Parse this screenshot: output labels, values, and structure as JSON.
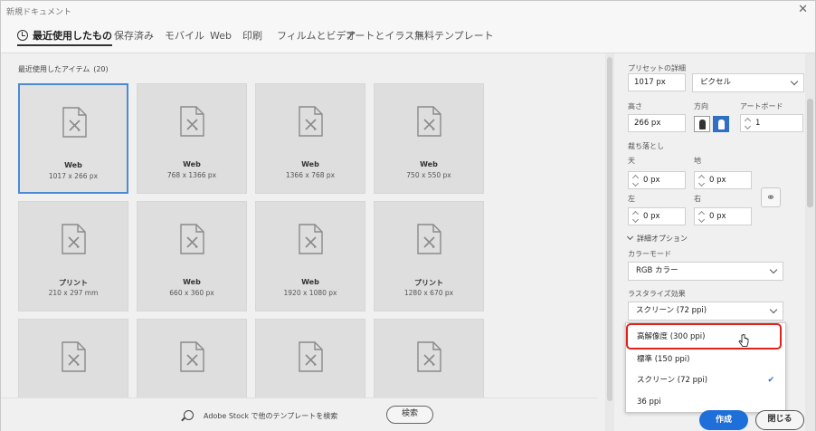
{
  "window": {
    "title": "新規ドキュメント",
    "close_glyph": "✕"
  },
  "tabs": [
    {
      "label": "最近使用したもの",
      "active": true
    },
    {
      "label": "保存済み"
    },
    {
      "label": "モバイル"
    },
    {
      "label": "Web"
    },
    {
      "label": "印刷"
    },
    {
      "label": "フィルムとビデオ"
    },
    {
      "label": "アートとイラスト"
    },
    {
      "label": "無料テンプレート"
    }
  ],
  "recent": {
    "label": "最近使用したアイテム",
    "count": "(20)",
    "items": [
      {
        "name": "Web",
        "size": "1017 x 266 px",
        "selected": true
      },
      {
        "name": "Web",
        "size": "768 x 1366 px"
      },
      {
        "name": "Web",
        "size": "1366 x 768 px"
      },
      {
        "name": "Web",
        "size": "750 x 550 px"
      },
      {
        "name": "プリント",
        "size": "210 x 297 mm"
      },
      {
        "name": "Web",
        "size": "660 x 360 px"
      },
      {
        "name": "Web",
        "size": "1920 x 1080 px"
      },
      {
        "name": "プリント",
        "size": "1280 x 670 px"
      },
      {
        "name": "",
        "size": ""
      },
      {
        "name": "",
        "size": ""
      },
      {
        "name": "",
        "size": ""
      },
      {
        "name": "",
        "size": ""
      }
    ]
  },
  "stock": {
    "text": "Adobe Stock で他のテンプレートを検索",
    "search_label": "検索",
    "icon": "search-icon"
  },
  "preset": {
    "header": "プリセットの詳細",
    "width": "1017 px",
    "unit": "ピクセル",
    "height_label": "高さ",
    "height": "266 px",
    "orientation_label": "方向",
    "artboard_label": "アートボード",
    "artboard": "1",
    "bleed_label": "裁ち落とし",
    "top_label": "天",
    "top": "0 px",
    "bottom_label": "地",
    "bottom": "0 px",
    "left_label": "左",
    "left": "0 px",
    "right_label": "右",
    "right": "0 px",
    "advanced_label": "詳細オプション",
    "color_mode_label": "カラーモード",
    "color_mode": "RGB カラー",
    "raster_label": "ラスタライズ効果",
    "raster": "スクリーン (72 ppi)"
  },
  "dropdown": {
    "options": [
      {
        "label": "高解像度 (300 ppi)"
      },
      {
        "label": "標準 (150 ppi)"
      },
      {
        "label": "スクリーン (72 ppi)",
        "checked": true
      },
      {
        "label": "36 ppi"
      }
    ],
    "check_glyph": "✔"
  },
  "footer": {
    "create_label": "作成",
    "close_label": "閉じる"
  },
  "colors": {
    "accent": "#1e6fd9",
    "selection": "#4a8bd6",
    "highlight": "#e0201b"
  }
}
